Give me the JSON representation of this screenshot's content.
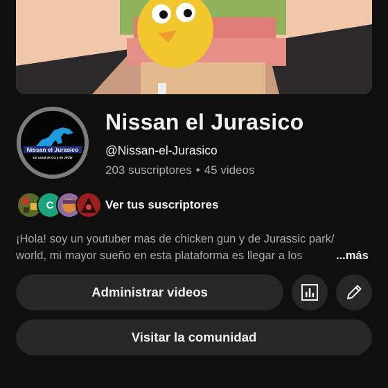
{
  "channel": {
    "name": "Nissan el Jurasico",
    "handle": "@Nissan-el-Jurasico",
    "subscribers": "203 suscriptores",
    "separator": "•",
    "videos": "45 videos"
  },
  "avatar": {
    "title": "Nissan el Jurasico",
    "subtitle": "Un canal de CG y de JPJW"
  },
  "subscribers_row": {
    "link_label": "Ver tus suscriptores",
    "letter_avatar": "C"
  },
  "description": {
    "line1": "¡Hola! soy un youtuber mas de chicken gun y de Jurassic park/",
    "line2": "world, mi mayor sueño en esta plataforma es llegar a los",
    "more_label": "...más"
  },
  "buttons": {
    "manage_videos": "Administrar videos",
    "visit_community": "Visitar la comunidad"
  },
  "icons": {
    "analytics": "analytics-icon",
    "edit": "pencil-icon"
  },
  "colors": {
    "background": "#0f0f0f",
    "button_bg": "#272727",
    "secondary_text": "#aaaaaa",
    "letter_avatar_bg": "#1ba57b"
  }
}
